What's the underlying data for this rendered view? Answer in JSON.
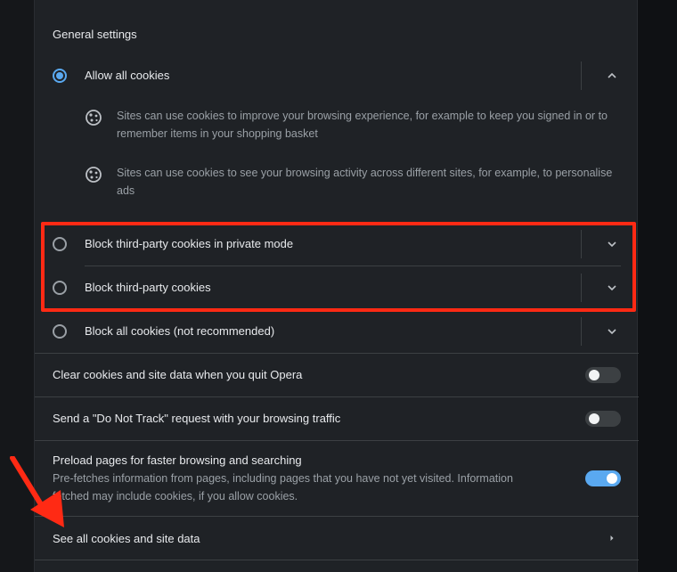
{
  "section_title": "General settings",
  "radios": [
    {
      "label": "Allow all cookies",
      "checked": true,
      "expanded": true
    },
    {
      "label": "Block third-party cookies in private mode",
      "checked": false,
      "expanded": false
    },
    {
      "label": "Block third-party cookies",
      "checked": false,
      "expanded": false
    },
    {
      "label": "Block all cookies (not recommended)",
      "checked": false,
      "expanded": false
    }
  ],
  "allow_details": [
    {
      "icon": "cookie-icon",
      "text": "Sites can use cookies to improve your browsing experience, for example to keep you signed in or to remember items in your shopping basket"
    },
    {
      "icon": "cookie-icon",
      "text": "Sites can use cookies to see your browsing activity across different sites, for example, to personalise ads"
    }
  ],
  "toggles": [
    {
      "label": "Clear cookies and site data when you quit Opera",
      "on": false
    },
    {
      "label": "Send a \"Do Not Track\" request with your browsing traffic",
      "on": false
    },
    {
      "label": "Preload pages for faster browsing and searching",
      "description": "Pre-fetches information from pages, including pages that you have not yet visited. Information fetched may include cookies, if you allow cookies.",
      "on": true
    }
  ],
  "link_row": {
    "label": "See all cookies and site data",
    "icon": "chevron-right-icon"
  },
  "colors": {
    "accent": "#5aa9f0",
    "highlight": "#ff2a14",
    "panel": "#1f2226"
  }
}
